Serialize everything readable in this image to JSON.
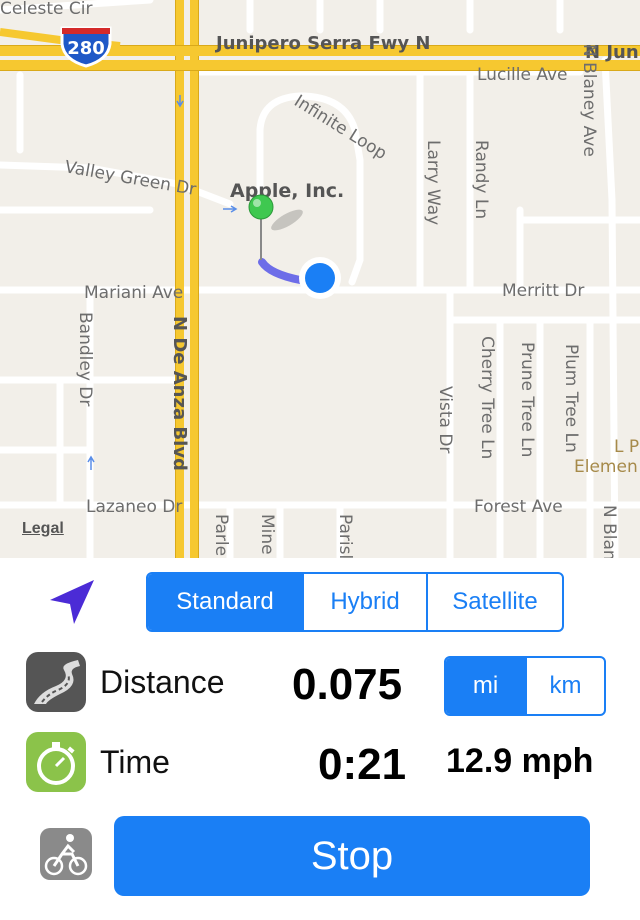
{
  "map": {
    "highway_shield": "280",
    "legal_label": "Legal",
    "poi_label": "Apple, Inc.",
    "streets": {
      "celeste": "Celeste Cir",
      "junipero": "Junipero Serra Fwy N",
      "junipero_right": "N Jun",
      "lucille": "Lucille Ave",
      "n_blaney": "N Blaney Ave",
      "infinite_loop": "Infinite Loop",
      "valley_green": "Valley Green Dr",
      "larry": "Larry Way",
      "randy": "Randy Ln",
      "merritt": "Merritt Dr",
      "mariani": "Mariani Ave",
      "bandley": "Bandley Dr",
      "de_anza": "N De Anza Blvd",
      "cherry": "Cherry Tree Ln",
      "prune": "Prune Tree Ln",
      "plum": "Plum Tree Ln",
      "vista": "Vista Dr",
      "lazaneo": "Lazaneo Dr",
      "forest": "Forest Ave",
      "parle": "Parle",
      "mine": "Mine",
      "parisl": "Parisl",
      "n_blan": "N Blan",
      "elem": "L P\nElemen"
    }
  },
  "map_types": [
    {
      "label": "Standard",
      "selected": true
    },
    {
      "label": "Hybrid",
      "selected": false
    },
    {
      "label": "Satellite",
      "selected": false
    }
  ],
  "distance": {
    "label": "Distance",
    "value": "0.075"
  },
  "units": [
    {
      "label": "mi",
      "selected": true
    },
    {
      "label": "km",
      "selected": false
    }
  ],
  "time": {
    "label": "Time",
    "value": "0:21"
  },
  "speed": "12.9 mph",
  "stop_label": "Stop",
  "colors": {
    "accent": "#1a7ff5",
    "route": "#6d6de8",
    "pin": "#3fc850",
    "location_dot": "#1a7ff5",
    "highway": "#f6c830",
    "time_icon": "#8bc34a",
    "distance_icon": "#555555",
    "bike_icon": "#8a8a8a"
  },
  "icons": {
    "location": "location-arrow-icon",
    "distance": "road-icon",
    "time": "stopwatch-icon",
    "bike": "cyclist-icon"
  }
}
